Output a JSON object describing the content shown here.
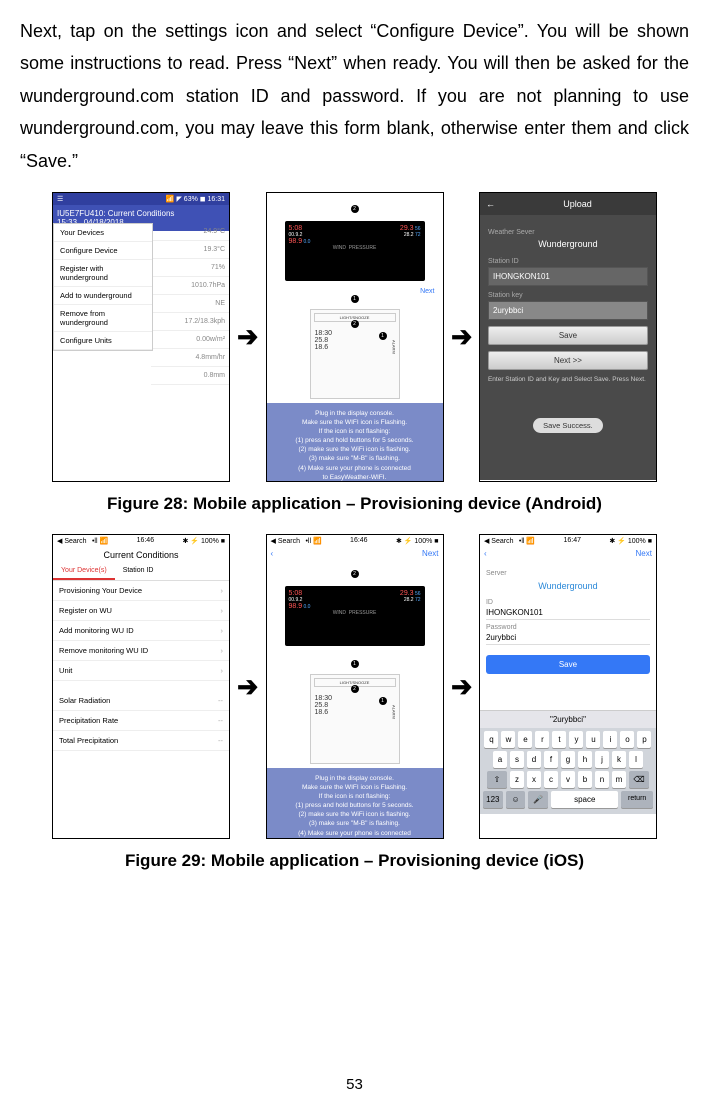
{
  "body_text": "Next, tap on the settings icon and select “Configure Device”. You will be shown some instructions to read. Press “Next” when ready. You will then be asked for the wunderground.com station ID and password. If you are not planning to use wunderground.com, you may leave this form blank, otherwise enter them and click “Save.”",
  "figure28_caption": "Figure 28: Mobile application – Provisioning device (Android)",
  "figure29_caption": "Figure 29: Mobile application – Provisioning device (iOS)",
  "page_number": "53",
  "android": {
    "status_left": "☰",
    "status_right": "📶 ◤ 63% ◼ 16:31",
    "header_line1": "IU5E7FU410: Current Conditions",
    "header_line2": "15:33   04/18/2018",
    "menu": [
      "Your Devices",
      "Configure Device",
      "Register with wunderground",
      "Add to wunderground",
      "Remove from wunderground",
      "Configure Units"
    ],
    "bg_rows": [
      "24.9°C",
      "19.3°C",
      "71%",
      "1010.7hPa",
      "NE",
      "17.2/18.3kph",
      "0.00w/m²",
      "4.8mm/hr",
      "0.8mm"
    ]
  },
  "instr": {
    "next_label": "Next",
    "display_time": "5:08",
    "display_temp1": "29.3",
    "display_temp2": "28.2",
    "display_hum1": "56",
    "display_hum2": "72",
    "display_wind": "00.9.2",
    "display_pressure": "98.9",
    "display_labels": "WIND  PRESSURE",
    "light_snooze": "LIGHT/SNOOZE",
    "alarm": "ALARM",
    "sec_time": "18:30",
    "sec_temp": "25.8",
    "sec_temp2": "18.6",
    "text_lines": [
      "Plug in the display console.",
      "Make sure the WIFI icon is Flashing.",
      "If the icon is not flashing:",
      "(1) press and hold buttons for 5 seconds.",
      "(2) make sure the WiFi icon is flashing.",
      "(3) make sure \"M-B\" is flashing.",
      "(4) Make sure your phone is connected",
      "to EasyWeather-WIFI."
    ]
  },
  "upload": {
    "title": "Upload",
    "back": "←",
    "server_label": "Weather Sever",
    "server_value": "Wunderground",
    "station_id_label": "Station ID",
    "station_id_value": "IHONGKON101",
    "station_key_label": "Station key",
    "station_key_value": "2urybbci",
    "save_btn": "Save",
    "next_btn": "Next >>",
    "hint": "Enter Station ID and Key and Select Save. Press Next.",
    "success": "Save Success."
  },
  "ios1": {
    "status_left": "◀ Search  •ll 📶",
    "status_time": "16:46",
    "status_right": "✱ ⚡ 100% ■",
    "title": "Current Conditions",
    "tab_left": "Your Device(s)",
    "tab_right": "Station ID",
    "items": [
      "Provisioning Your Device",
      "Register on WU",
      "Add monitoring WU ID",
      "Remove monitoring WU ID",
      "Unit"
    ],
    "footer_items": [
      "Solar Radiation",
      "Precipitation Rate",
      "Total Precipitation"
    ]
  },
  "ios2": {
    "status_left": "◀ Search  •ll 📶",
    "status_time": "16:46",
    "status_right": "✱ ⚡ 100% ■",
    "back": "‹",
    "next": "Next"
  },
  "ios3": {
    "status_left": "◀ Search  •ll 📶",
    "status_time": "16:47",
    "status_right": "✱ ⚡ 100% ■",
    "back": "‹",
    "next": "Next",
    "server_label": "Server",
    "server_value": "Wunderground",
    "id_label": "ID",
    "id_value": "IHONGKON101",
    "pwd_label": "Password",
    "pwd_value": "2urybbci",
    "save_btn": "Save",
    "suggest": "\"2urybbci\"",
    "kb_row1": [
      "q",
      "w",
      "e",
      "r",
      "t",
      "y",
      "u",
      "i",
      "o",
      "p"
    ],
    "kb_row2": [
      "a",
      "s",
      "d",
      "f",
      "g",
      "h",
      "j",
      "k",
      "l"
    ],
    "kb_row3": [
      "z",
      "x",
      "c",
      "v",
      "b",
      "n",
      "m"
    ],
    "kb_123": "123",
    "kb_space": "space",
    "kb_return": "return"
  },
  "badges": {
    "b1": "1",
    "b2": "2"
  }
}
